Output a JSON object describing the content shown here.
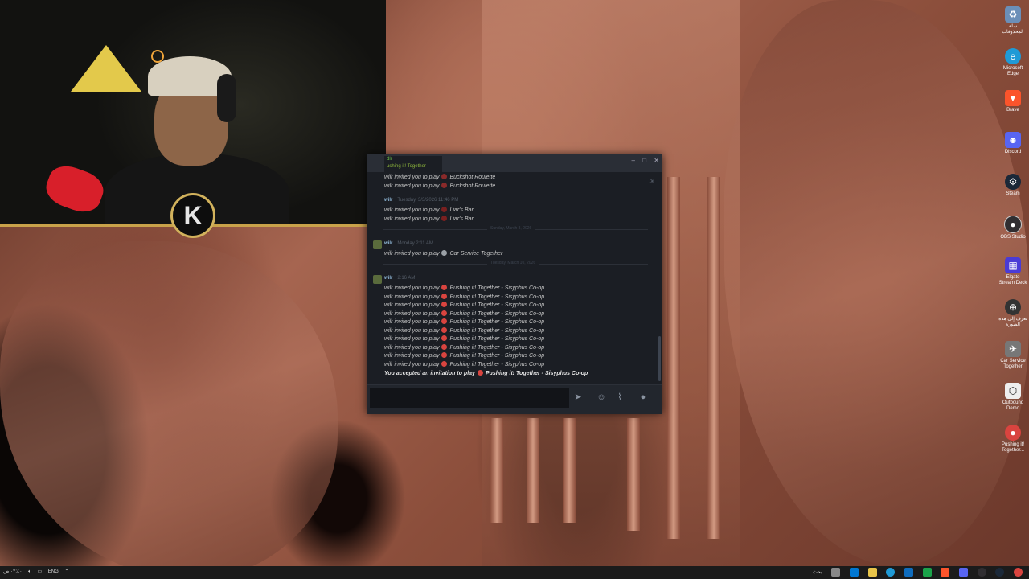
{
  "colors": {
    "chat_bg": "#1b1e24",
    "accent_green": "#6dbf4b",
    "frame_gold": "#c9a24a",
    "taskbar": "#1b1b1b"
  },
  "chat": {
    "tab_name": "dlr",
    "tab_subtitle": "ushing it! Together",
    "window_buttons": [
      "–",
      "□",
      "✕"
    ],
    "sender": "wilr",
    "separators": [
      "Sunday, March 8, 2026",
      "Tuesday, March 10, 2026"
    ],
    "timestamps": [
      "Tuesday, 3/3/2026 11:46 PM",
      "Monday 2:11 AM",
      "2:16 AM"
    ],
    "invite_prefix": "wilr invited you to play",
    "games": {
      "buckshot": "Buckshot Roulette",
      "liars": "Liar's Bar",
      "car": "Car Service Together",
      "pushing": "Pushing it! Together - Sisyphus Co-op"
    },
    "accepted_prefix": "You accepted an invitation to play",
    "input_placeholder": ""
  },
  "desktop_icons": [
    {
      "label": "سلة المحذوفات",
      "icon": "recycle-bin-icon",
      "color": "#6b8fb8"
    },
    {
      "label": "Microsoft Edge",
      "icon": "edge-icon",
      "color": "#1f9ad6"
    },
    {
      "label": "Brave",
      "icon": "brave-icon",
      "color": "#fb542b"
    },
    {
      "label": "Discord",
      "icon": "discord-icon",
      "color": "#5865f2"
    },
    {
      "label": "Steam",
      "icon": "steam-icon",
      "color": "#1b2838"
    },
    {
      "label": "OBS Studio",
      "icon": "obs-icon",
      "color": "#302e31"
    },
    {
      "label": "Elgato Stream Deck",
      "icon": "stream-deck-icon",
      "color": "#4a3bd6"
    },
    {
      "label": "تعرف إلى هذه الصورة",
      "icon": "camera-icon",
      "color": "#333"
    },
    {
      "label": "Car Service Together",
      "icon": "car-service-icon",
      "color": "#777"
    },
    {
      "label": "Outbound Demo",
      "icon": "outbound-icon",
      "color": "#eee"
    },
    {
      "label": "Pushing it! Together...",
      "icon": "pushing-icon",
      "color": "#d9443f"
    }
  ],
  "taskbar": {
    "time": "٠٢:٤٠ ص",
    "date": "٢٠٢٦/٣/١١",
    "lang": "ENG",
    "search_label": "بحث"
  }
}
